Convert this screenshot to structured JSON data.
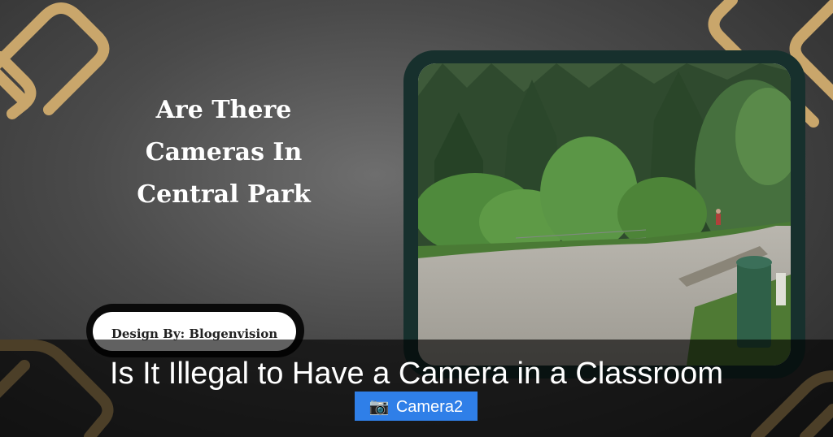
{
  "headline": {
    "line1": "Are There",
    "line2": "Cameras In",
    "line3": "Central Park"
  },
  "credit": "Design By: Blogenvision",
  "caption": "Is It Illegal to Have a Camera in a Classroom",
  "tag": {
    "icon": "camera-icon",
    "label": "Camera2"
  },
  "colors": {
    "gold": "#c9a66b",
    "tag_bg": "#2f7fe8",
    "frame": "#17302d",
    "overlay": "rgba(0,0,0,0.62)"
  }
}
